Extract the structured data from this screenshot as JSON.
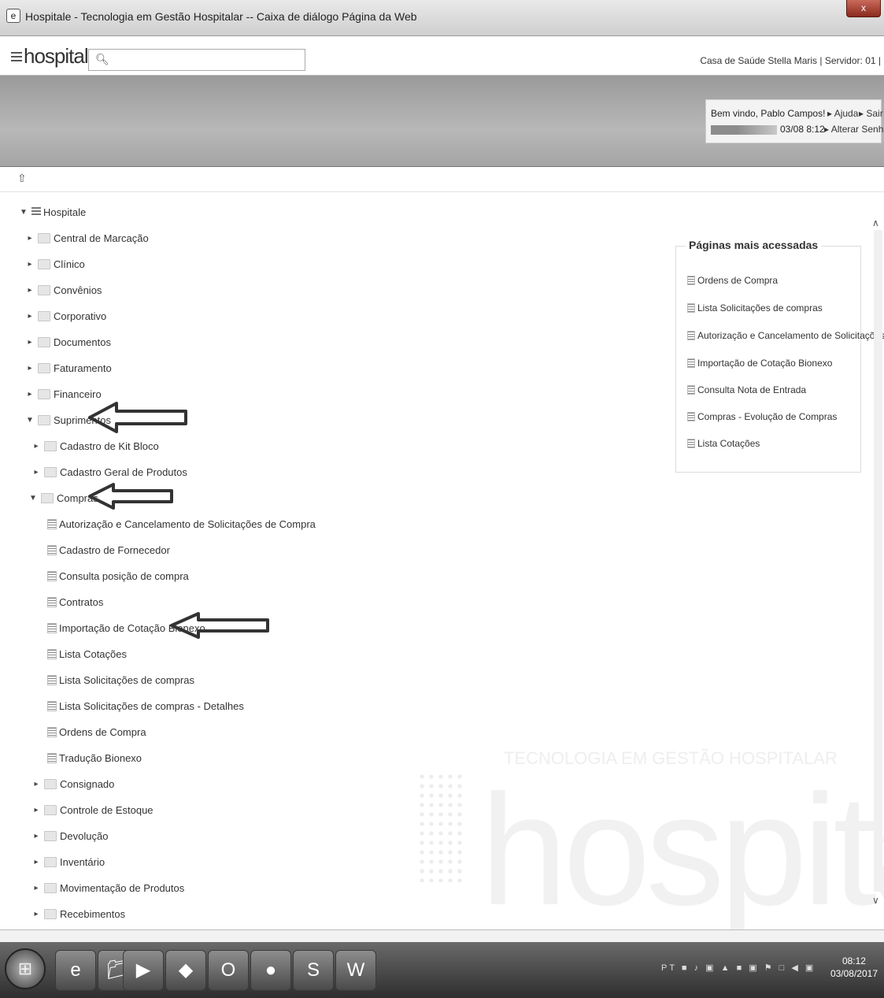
{
  "window": {
    "title": "Hospitale - Tecnologia em Gestão Hospitalar -- Caixa de diálogo Página da Web",
    "close_label": "x"
  },
  "header": {
    "logo": "hospitale",
    "search_placeholder": "",
    "server_info": "Casa de Saúde Stella Maris  |  Servidor: 01  |"
  },
  "user": {
    "welcome": "Bem vindo, Pablo Campos!",
    "datetime": "03/08 8:12",
    "help": "Ajuda",
    "exit": "Sair",
    "change_password": "Alterar Senha"
  },
  "tree": {
    "root": "Hospitale",
    "items": [
      {
        "label": "Central de Marcação"
      },
      {
        "label": "Clínico"
      },
      {
        "label": "Convênios"
      },
      {
        "label": "Corporativo"
      },
      {
        "label": "Documentos"
      },
      {
        "label": "Faturamento"
      },
      {
        "label": "Financeiro"
      },
      {
        "label": "Suprimentos"
      },
      {
        "label": "Cadastro de Kit Bloco"
      },
      {
        "label": "Cadastro Geral de Produtos"
      },
      {
        "label": "Compras"
      },
      {
        "label": "Autorização e Cancelamento de Solicitações de Compra"
      },
      {
        "label": "Cadastro de Fornecedor"
      },
      {
        "label": "Consulta posição de compra"
      },
      {
        "label": "Contratos"
      },
      {
        "label": "Importação de Cotação Bionexo"
      },
      {
        "label": "Lista Cotações"
      },
      {
        "label": "Lista Solicitações de compras"
      },
      {
        "label": "Lista Solicitações de compras - Detalhes"
      },
      {
        "label": "Ordens de Compra"
      },
      {
        "label": "Tradução Bionexo"
      },
      {
        "label": "Consignado"
      },
      {
        "label": "Controle de Estoque"
      },
      {
        "label": "Devolução"
      },
      {
        "label": "Inventário"
      },
      {
        "label": "Movimentação de Produtos"
      },
      {
        "label": "Recebimentos"
      }
    ]
  },
  "most_accessed": {
    "title": "Páginas mais acessadas",
    "items": [
      "Ordens de Compra",
      "Lista Solicitações de compras",
      "Autorização e Cancelamento de Solicitações...",
      "Importação de Cotação Bionexo",
      "Consulta Nota de Entrada",
      "Compras - Evolução de Compras",
      "Lista Cotações"
    ]
  },
  "watermark": {
    "text": "hospitale",
    "subtitle": "TECNOLOGIA EM GESTÃO HOSPITALAR"
  },
  "taskbar": {
    "time": "08:12",
    "date": "03/08/2017",
    "tray_language": "PT"
  }
}
